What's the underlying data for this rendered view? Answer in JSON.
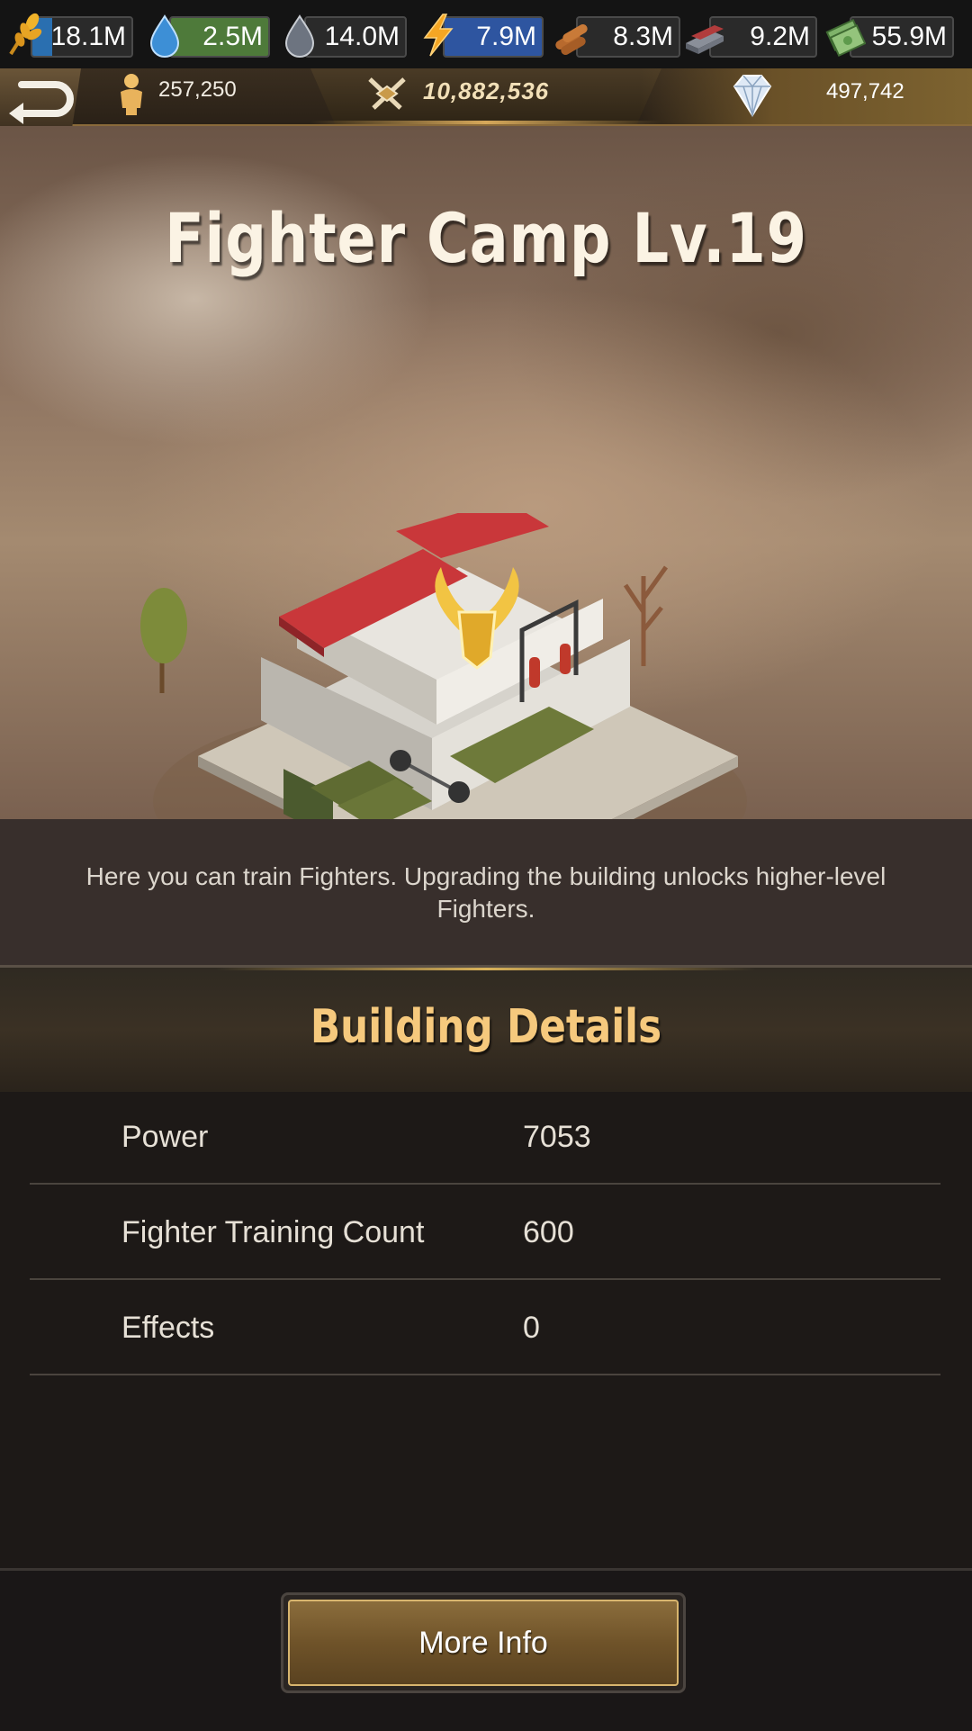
{
  "resources": [
    {
      "name": "food",
      "value": "18.1M",
      "fill": 0.2,
      "fill_color": "#2a6fb0",
      "icon": "wheat-icon"
    },
    {
      "name": "water",
      "value": "2.5M",
      "fill": 1.0,
      "fill_color": "#4e7a3a",
      "icon": "water-drop-icon"
    },
    {
      "name": "oil",
      "value": "14.0M",
      "fill": 0,
      "fill_color": "#2a6fb0",
      "icon": "oil-drop-icon"
    },
    {
      "name": "electricity",
      "value": "7.9M",
      "fill": 1.0,
      "fill_color": "#2e55a0",
      "icon": "lightning-icon"
    },
    {
      "name": "wood",
      "value": "8.3M",
      "fill": 0,
      "fill_color": "#2a6fb0",
      "icon": "logs-icon"
    },
    {
      "name": "steel",
      "value": "9.2M",
      "fill": 0,
      "fill_color": "#2a6fb0",
      "icon": "steel-bars-icon"
    },
    {
      "name": "cash",
      "value": "55.9M",
      "fill": 0,
      "fill_color": "#2a6fb0",
      "icon": "cash-stack-icon"
    }
  ],
  "header": {
    "population": "257,250",
    "power": "10,882,536",
    "gems": "497,742"
  },
  "building": {
    "title": "Fighter Camp Lv.19",
    "description": "Here you can train Fighters. Upgrading the building unlocks higher-level Fighters."
  },
  "details": {
    "heading": "Building Details",
    "rows": [
      {
        "label": "Power",
        "value": "7053"
      },
      {
        "label": "Fighter Training Count",
        "value": "600"
      },
      {
        "label": "Effects",
        "value": "0"
      }
    ]
  },
  "footer": {
    "button_label": "More Info"
  }
}
